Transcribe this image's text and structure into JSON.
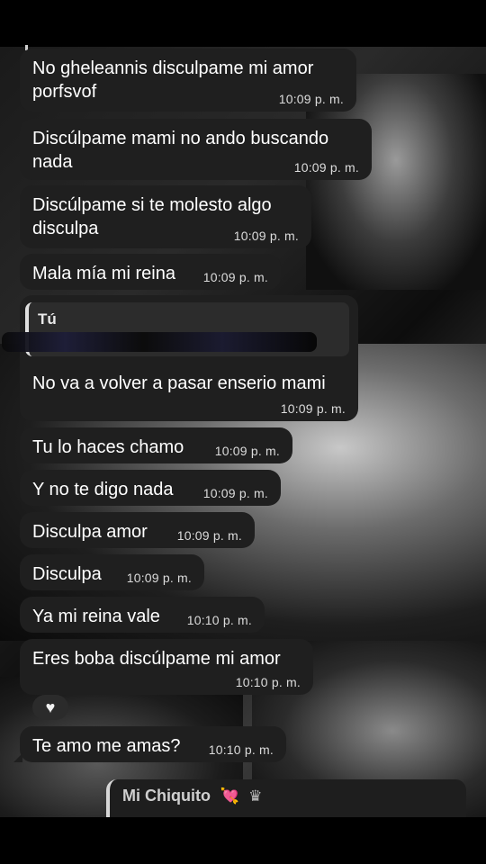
{
  "messages": [
    {
      "text": "No gheleannis disculpame mi amor\nporfsvof",
      "time": "10:09 p. m."
    },
    {
      "text": "Discúlpame mami no ando buscando\nnada",
      "time": "10:09 p. m."
    },
    {
      "text": "Discúlpame si te molesto algo\ndisculpa",
      "time": "10:09 p. m."
    },
    {
      "text": "Mala mía mi reina",
      "time": "10:09 p. m."
    },
    {
      "text": "No va a volver a pasar enserio mami",
      "time": "10:09 p. m.",
      "quoted_author": "Tú"
    },
    {
      "text": "Tu lo haces chamo",
      "time": "10:09 p. m."
    },
    {
      "text": "Y no te digo nada",
      "time": "10:09 p. m."
    },
    {
      "text": "Disculpa amor",
      "time": "10:09 p. m."
    },
    {
      "text": "Disculpa",
      "time": "10:09 p. m."
    },
    {
      "text": "Ya mi reina vale",
      "time": "10:10 p. m."
    },
    {
      "text": "Eres boba discúlpame mi amor",
      "time": "10:10 p. m."
    },
    {
      "text": "Te amo me amas?",
      "time": "10:10 p. m."
    }
  ],
  "reaction": {
    "icon": "heart-icon",
    "symbol": "♥"
  },
  "reply_preview": {
    "name": "Mi Chiquito",
    "emoji_1": "💘",
    "emoji_2": "♛"
  },
  "colors": {
    "bubble": "#1f1f1f",
    "text": "#ffffff",
    "time": "#dcdcdc"
  }
}
